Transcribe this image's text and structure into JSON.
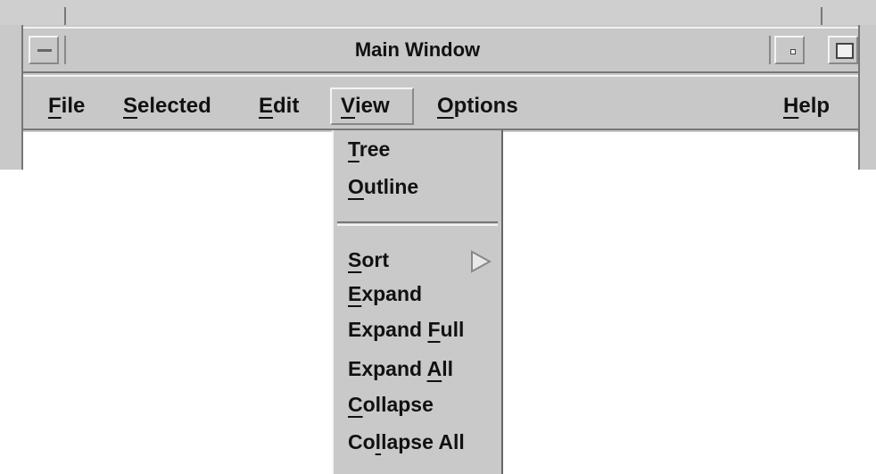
{
  "window": {
    "title": "Main Window"
  },
  "menubar": {
    "items": [
      {
        "label": "File",
        "mnemonic_index": 0
      },
      {
        "label": "Selected",
        "mnemonic_index": 0
      },
      {
        "label": "Edit",
        "mnemonic_index": 0
      },
      {
        "label": "View",
        "mnemonic_index": 0,
        "active": true
      },
      {
        "label": "Options",
        "mnemonic_index": 0
      },
      {
        "label": "Help",
        "mnemonic_index": 0
      }
    ]
  },
  "view_menu": {
    "group1": [
      {
        "label": "Tree",
        "mnemonic": "T"
      },
      {
        "label": "Outline",
        "mnemonic": "O"
      }
    ],
    "group2": [
      {
        "label": "Sort",
        "mnemonic": "S",
        "submenu": true
      },
      {
        "label": "Expand",
        "mnemonic": "E"
      },
      {
        "label": "Expand Full",
        "mnemonic": "F"
      },
      {
        "label": "Expand All",
        "mnemonic": "A"
      },
      {
        "label": "Collapse",
        "mnemonic": "C"
      },
      {
        "label": "Collapse All",
        "mnemonic": "l"
      }
    ]
  },
  "icons": {
    "window_menu": "window-menu-icon",
    "minimize": "minimize-icon",
    "maximize": "maximize-icon",
    "submenu_arrow": "cascade-arrow-icon"
  }
}
